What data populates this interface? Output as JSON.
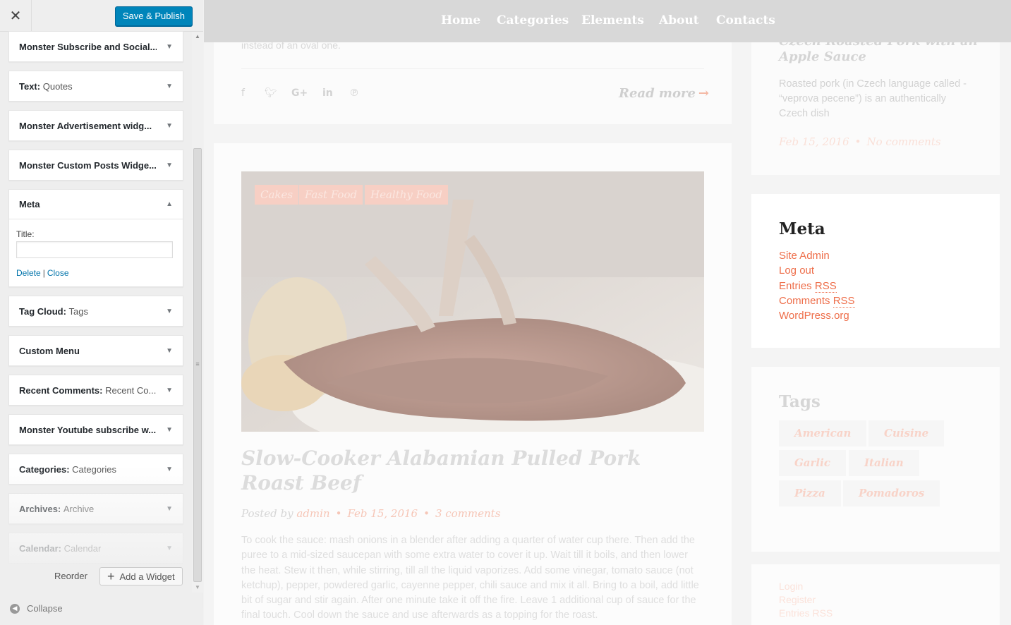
{
  "sidebar": {
    "close_glyph": "✕",
    "save_label": "Save & Publish",
    "widgets": [
      {
        "title": "Monster Subscribe and Social...",
        "subtitle": ""
      },
      {
        "title": "Text:",
        "subtitle": "Quotes"
      },
      {
        "title": "Monster Advertisement widg...",
        "subtitle": ""
      },
      {
        "title": "Monster Custom Posts Widge...",
        "subtitle": ""
      },
      {
        "title": "Meta",
        "subtitle": ""
      },
      {
        "title": "Tag Cloud:",
        "subtitle": "Tags"
      },
      {
        "title": "Custom Menu",
        "subtitle": ""
      },
      {
        "title": "Recent Comments:",
        "subtitle": "Recent Co..."
      },
      {
        "title": "Monster Youtube subscribe w...",
        "subtitle": ""
      },
      {
        "title": "Categories:",
        "subtitle": "Categories"
      },
      {
        "title": "Archives:",
        "subtitle": "Archive"
      },
      {
        "title": "Calendar:",
        "subtitle": "Calendar"
      }
    ],
    "meta_form": {
      "title_label": "Title:",
      "title_value": "",
      "delete_label": "Delete",
      "separator": "|",
      "close_label": "Close"
    },
    "reorder_label": "Reorder",
    "add_widget_label": "Add a Widget",
    "collapse_label": "Collapse"
  },
  "preview": {
    "nav": [
      "Home",
      "Categories",
      "Elements",
      "About",
      "Contacts"
    ],
    "prev_post_excerpt": "instead of an oval one.",
    "read_more": "Read more",
    "post": {
      "categories": [
        "Cakes",
        "Fast Food",
        "Healthy Food"
      ],
      "title": "Slow-Cooker Alabamian Pulled Pork Roast Beef",
      "posted_by": "Posted by",
      "author": "admin",
      "date": "Feb 15, 2016",
      "comments": "3 comments",
      "body": "To cook the sauce: mash onions in a blender after adding a quarter of water cup there. Then add the puree to a mid-sized saucepan with some extra water to cover it up. Wait till it boils, and then lower the heat. Stew it then, while stirring, till all the liquid vaporizes. Add some vinegar, tomato sauce (not ketchup), pepper, powdered garlic, cayenne pepper, chili sauce and mix it all. Bring to a boil, add little bit of sugar and stir again. After one minute take it off the fire. Leave 1 additional cup of sauce for the final touch. Cool down the sauce and use afterwards as a topping for the roast."
    },
    "side_post": {
      "title": "Czech Roasted Pork with an Apple Sauce",
      "excerpt": "Roasted pork (in Czech language called - “veprova pecene”) is an authentically Czech dish",
      "date": "Feb 15, 2016",
      "comments": "No comments"
    },
    "meta_widget": {
      "heading": "Meta",
      "links": [
        {
          "text": "Site Admin",
          "abbr": ""
        },
        {
          "text": "Log out",
          "abbr": ""
        },
        {
          "text": "Entries ",
          "abbr": "RSS"
        },
        {
          "text": "Comments ",
          "abbr": "RSS"
        },
        {
          "text": "WordPress.org",
          "abbr": ""
        }
      ]
    },
    "tags_widget": {
      "heading": "Tags",
      "tags": [
        "American",
        "Cuisine",
        "Garlic",
        "Italian",
        "Pizza",
        "Pomadoros"
      ]
    },
    "bottom_links": [
      "Login",
      "Register",
      "Entries RSS"
    ]
  },
  "colors": {
    "save_button": "#0085ba",
    "link_blue": "#0073aa",
    "accent_orange": "#ee6e4a",
    "nav_bar": "#d8d8d8"
  },
  "icons": [
    "close-icon",
    "arrow-down-icon",
    "arrow-up-icon",
    "plus-icon",
    "collapse-icon",
    "facebook-icon",
    "twitter-icon",
    "google-plus-icon",
    "linkedin-icon",
    "pinterest-icon",
    "arrow-right-icon"
  ]
}
